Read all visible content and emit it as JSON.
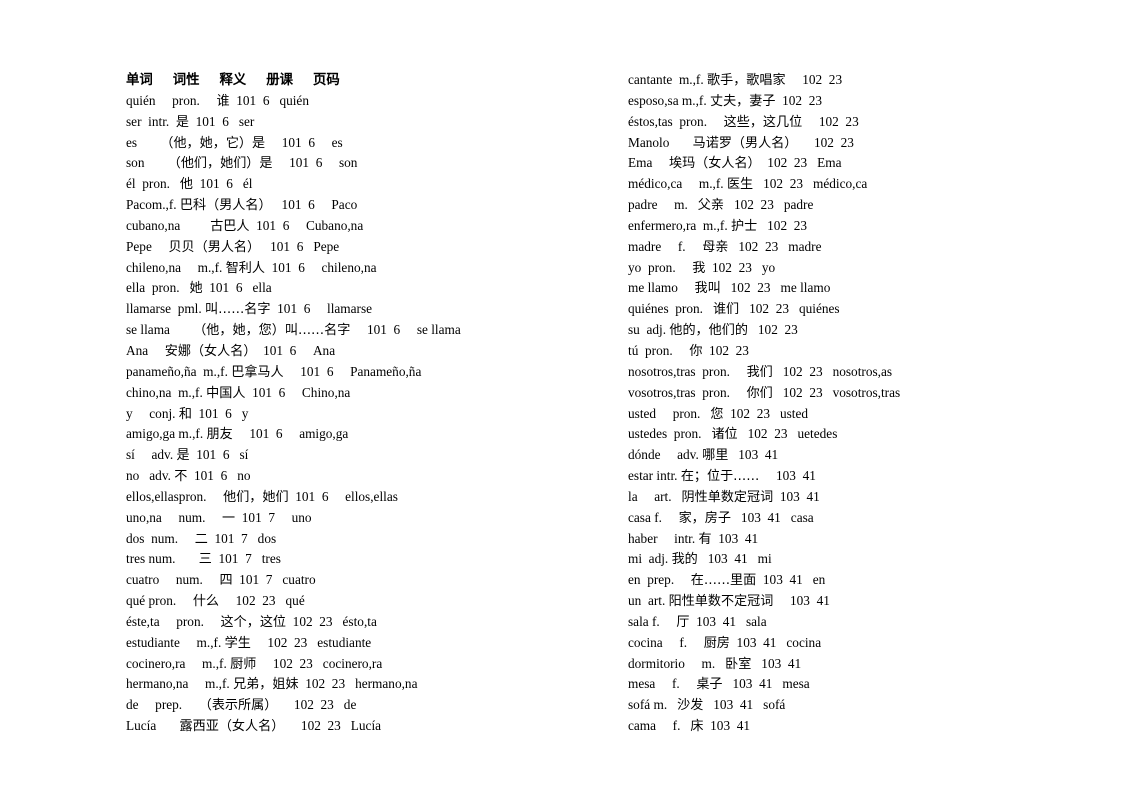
{
  "document": {
    "title": "Spanish-Chinese vocabulary glossary",
    "columns_count": 2
  },
  "header": {
    "columns": [
      "单词",
      "词性",
      "释义",
      "册课",
      "页码"
    ],
    "raw": "单词  词性  释义  册课  页码"
  },
  "left_column": {
    "rows": [
      "quién  pron.  谁  101  6  quién",
      "ser  intr.  是  101  6  ser",
      "es   （他，她，它）是  101  6   es",
      "son   （他们，她们）是  101  6   son",
      "él  pron.  他  101  6  él",
      "Pacom.,f. 巴科（男人名）  101  6   Paco",
      "cubano,na    古巴人  101  6   Cubano,na",
      "Pepe   贝贝（男人名）  101  6  Pepe",
      "chileno,na   m.,f. 智利人  101  6   chileno,na",
      "ella  pron.  她  101  6  ella",
      "llamarse  pml. 叫……名字  101  6   llamarse",
      "se llama   （他，她，您）叫……名字  101  6   se llama",
      "Ana  安娜（女人名）  101  6   Ana",
      "panameño,ña  m.,f. 巴拿马人  101  6   Panameño,ña",
      "chino,na  m.,f. 中国人  101  6   Chino,na",
      "y   conj. 和  101  6  y",
      "amigo,ga m.,f. 朋友  101  6   amigo,ga",
      "sí   adv. 是  101  6  sí",
      "no  adv. 不  101  6  no",
      "ellos,ellaspron.  他们，她们  101  6   ellos,ellas",
      "uno,na   num.  一  101  7   uno",
      "dos  num.  二  101  7  dos",
      "tres num.   三  101  7  tres",
      "cuatro   num.  四  101  7  cuatro",
      "qué pron.  什么  102  23  qué",
      "éste,ta   pron.  这个，这位  102  23  ésto,ta",
      "estudiante  m.,f. 学生  102  23  estudiante",
      "cocinero,ra  m.,f. 厨师  102  23  cocinero,ra",
      "hermano,na  m.,f. 兄弟，姐妹  102  23  hermano,na",
      "de   prep.  （表示所属）  102  23  de",
      "Lucía   露西亚（女人名）  102  23  Lucía"
    ],
    "entries": [
      {
        "word": "quién",
        "pos": "pron.",
        "meaning": "谁",
        "book": "101",
        "lesson": "6",
        "form": "quién"
      },
      {
        "word": "ser",
        "pos": "intr.",
        "meaning": "是",
        "book": "101",
        "lesson": "6",
        "form": "ser"
      },
      {
        "word": "es",
        "pos": "",
        "meaning": "（他，她，它）是",
        "book": "101",
        "lesson": "6",
        "form": "es"
      },
      {
        "word": "son",
        "pos": "",
        "meaning": "（他们，她们）是",
        "book": "101",
        "lesson": "6",
        "form": "son"
      },
      {
        "word": "él",
        "pos": "pron.",
        "meaning": "他",
        "book": "101",
        "lesson": "6",
        "form": "él"
      },
      {
        "word": "Paco",
        "pos": "m.,f.",
        "meaning": "巴科（男人名）",
        "book": "101",
        "lesson": "6",
        "form": "Paco"
      },
      {
        "word": "cubano,na",
        "pos": "",
        "meaning": "古巴人",
        "book": "101",
        "lesson": "6",
        "form": "Cubano,na"
      },
      {
        "word": "Pepe",
        "pos": "",
        "meaning": "贝贝（男人名）",
        "book": "101",
        "lesson": "6",
        "form": "Pepe"
      },
      {
        "word": "chileno,na",
        "pos": "m.,f.",
        "meaning": "智利人",
        "book": "101",
        "lesson": "6",
        "form": "chileno,na"
      },
      {
        "word": "ella",
        "pos": "pron.",
        "meaning": "她",
        "book": "101",
        "lesson": "6",
        "form": "ella"
      },
      {
        "word": "llamarse",
        "pos": "pml.",
        "meaning": "叫……名字",
        "book": "101",
        "lesson": "6",
        "form": "llamarse"
      },
      {
        "word": "se llama",
        "pos": "",
        "meaning": "（他，她，您）叫……名字",
        "book": "101",
        "lesson": "6",
        "form": "se llama"
      },
      {
        "word": "Ana",
        "pos": "",
        "meaning": "安娜（女人名）",
        "book": "101",
        "lesson": "6",
        "form": "Ana"
      },
      {
        "word": "panameño,ña",
        "pos": "m.,f.",
        "meaning": "巴拿马人",
        "book": "101",
        "lesson": "6",
        "form": "Panameño,ña"
      },
      {
        "word": "chino,na",
        "pos": "m.,f.",
        "meaning": "中国人",
        "book": "101",
        "lesson": "6",
        "form": "Chino,na"
      },
      {
        "word": "y",
        "pos": "conj.",
        "meaning": "和",
        "book": "101",
        "lesson": "6",
        "form": "y"
      },
      {
        "word": "amigo,ga",
        "pos": "m.,f.",
        "meaning": "朋友",
        "book": "101",
        "lesson": "6",
        "form": "amigo,ga"
      },
      {
        "word": "sí",
        "pos": "adv.",
        "meaning": "是",
        "book": "101",
        "lesson": "6",
        "form": "sí"
      },
      {
        "word": "no",
        "pos": "adv.",
        "meaning": "不",
        "book": "101",
        "lesson": "6",
        "form": "no"
      },
      {
        "word": "ellos,ellas",
        "pos": "pron.",
        "meaning": "他们，她们",
        "book": "101",
        "lesson": "6",
        "form": "ellos,ellas"
      },
      {
        "word": "uno,na",
        "pos": "num.",
        "meaning": "一",
        "book": "101",
        "lesson": "7",
        "form": "uno"
      },
      {
        "word": "dos",
        "pos": "num.",
        "meaning": "二",
        "book": "101",
        "lesson": "7",
        "form": "dos"
      },
      {
        "word": "tres",
        "pos": "num.",
        "meaning": "三",
        "book": "101",
        "lesson": "7",
        "form": "tres"
      },
      {
        "word": "cuatro",
        "pos": "num.",
        "meaning": "四",
        "book": "101",
        "lesson": "7",
        "form": "cuatro"
      },
      {
        "word": "qué",
        "pos": "pron.",
        "meaning": "什么",
        "book": "102",
        "lesson": "23",
        "form": "qué"
      },
      {
        "word": "éste,ta",
        "pos": "pron.",
        "meaning": "这个，这位",
        "book": "102",
        "lesson": "23",
        "form": "ésto,ta"
      },
      {
        "word": "estudiante",
        "pos": "m.,f.",
        "meaning": "学生",
        "book": "102",
        "lesson": "23",
        "form": "estudiante"
      },
      {
        "word": "cocinero,ra",
        "pos": "m.,f.",
        "meaning": "厨师",
        "book": "102",
        "lesson": "23",
        "form": "cocinero,ra"
      },
      {
        "word": "hermano,na",
        "pos": "m.,f.",
        "meaning": "兄弟，姐妹",
        "book": "102",
        "lesson": "23",
        "form": "hermano,na"
      },
      {
        "word": "de",
        "pos": "prep.",
        "meaning": "（表示所属）",
        "book": "102",
        "lesson": "23",
        "form": "de"
      },
      {
        "word": "Lucía",
        "pos": "",
        "meaning": "露西亚（女人名）",
        "book": "102",
        "lesson": "23",
        "form": "Lucía"
      }
    ]
  },
  "right_column": {
    "rows": [
      "cantante  m.,f. 歌手，歌唱家  102  23",
      "esposo,sa m.,f. 丈夫，妻子  102  23",
      "éstos,tas  pron.  这些，这几位  102  23",
      "Manolo   马诺罗（男人名）  102  23",
      "Ema  埃玛（女人名）  102  23  Ema",
      "médico,ca  m.,f. 医生  102  23  médico,ca",
      "padre   m.  父亲  102  23  padre",
      "enfermero,ra  m.,f. 护士  102  23",
      "madre   f.   母亲  102  23  madre",
      "yo  pron.   我  102  23  yo",
      "me llamo  我叫  102  23  me llamo",
      "quiénes  pron.  谁们  102  23  quiénes",
      "su  adj. 他的，他们的  102  23",
      "tú  pron.   你  102  23",
      "nosotros,tras  pron.  我们  102  23  nosotros,as",
      "vosotros,tras  pron.  你们  102  23  vosotros,tras",
      "usted   pron.  您  102  23  usted",
      "ustedes  pron.  诸位  102  23  uetedes",
      "dónde   adv. 哪里  103  41",
      "estar intr. 在；位于……  103  41",
      "la   art.  阴性单数定冠词  103  41",
      "casa f.   家，房子  103  41  casa",
      "haber   intr. 有  103  41",
      "mi  adj. 我的  103  41  mi",
      "en  prep.   在……里面  103  41  en",
      "un  art. 阳性单数不定冠词  103  41",
      "sala f.   厅  103  41  sala",
      "cocina   f.   厨房  103  41  cocina",
      "dormitorio   m.  卧室  103  41",
      "mesa   f.   桌子  103  41  mesa",
      "sofá m.  沙发  103  41  sofá",
      "cama   f.  床  103  41"
    ],
    "entries": [
      {
        "word": "cantante",
        "pos": "m.,f.",
        "meaning": "歌手，歌唱家",
        "book": "102",
        "lesson": "23",
        "form": ""
      },
      {
        "word": "esposo,sa",
        "pos": "m.,f.",
        "meaning": "丈夫，妻子",
        "book": "102",
        "lesson": "23",
        "form": ""
      },
      {
        "word": "éstos,tas",
        "pos": "pron.",
        "meaning": "这些，这几位",
        "book": "102",
        "lesson": "23",
        "form": ""
      },
      {
        "word": "Manolo",
        "pos": "",
        "meaning": "马诺罗（男人名）",
        "book": "102",
        "lesson": "23",
        "form": ""
      },
      {
        "word": "Ema",
        "pos": "",
        "meaning": "埃玛（女人名）",
        "book": "102",
        "lesson": "23",
        "form": "Ema"
      },
      {
        "word": "médico,ca",
        "pos": "m.,f.",
        "meaning": "医生",
        "book": "102",
        "lesson": "23",
        "form": "médico,ca"
      },
      {
        "word": "padre",
        "pos": "m.",
        "meaning": "父亲",
        "book": "102",
        "lesson": "23",
        "form": "padre"
      },
      {
        "word": "enfermero,ra",
        "pos": "m.,f.",
        "meaning": "护士",
        "book": "102",
        "lesson": "23",
        "form": ""
      },
      {
        "word": "madre",
        "pos": "f.",
        "meaning": "母亲",
        "book": "102",
        "lesson": "23",
        "form": "madre"
      },
      {
        "word": "yo",
        "pos": "pron.",
        "meaning": "我",
        "book": "102",
        "lesson": "23",
        "form": "yo"
      },
      {
        "word": "me llamo",
        "pos": "",
        "meaning": "我叫",
        "book": "102",
        "lesson": "23",
        "form": "me llamo"
      },
      {
        "word": "quiénes",
        "pos": "pron.",
        "meaning": "谁们",
        "book": "102",
        "lesson": "23",
        "form": "quiénes"
      },
      {
        "word": "su",
        "pos": "adj.",
        "meaning": "他的，他们的",
        "book": "102",
        "lesson": "23",
        "form": ""
      },
      {
        "word": "tú",
        "pos": "pron.",
        "meaning": "你",
        "book": "102",
        "lesson": "23",
        "form": ""
      },
      {
        "word": "nosotros,tras",
        "pos": "pron.",
        "meaning": "我们",
        "book": "102",
        "lesson": "23",
        "form": "nosotros,as"
      },
      {
        "word": "vosotros,tras",
        "pos": "pron.",
        "meaning": "你们",
        "book": "102",
        "lesson": "23",
        "form": "vosotros,tras"
      },
      {
        "word": "usted",
        "pos": "pron.",
        "meaning": "您",
        "book": "102",
        "lesson": "23",
        "form": "usted"
      },
      {
        "word": "ustedes",
        "pos": "pron.",
        "meaning": "诸位",
        "book": "102",
        "lesson": "23",
        "form": "uetedes"
      },
      {
        "word": "dónde",
        "pos": "adv.",
        "meaning": "哪里",
        "book": "103",
        "lesson": "41",
        "form": ""
      },
      {
        "word": "estar",
        "pos": "intr.",
        "meaning": "在；位于……",
        "book": "103",
        "lesson": "41",
        "form": ""
      },
      {
        "word": "la",
        "pos": "art.",
        "meaning": "阴性单数定冠词",
        "book": "103",
        "lesson": "41",
        "form": ""
      },
      {
        "word": "casa",
        "pos": "f.",
        "meaning": "家，房子",
        "book": "103",
        "lesson": "41",
        "form": "casa"
      },
      {
        "word": "haber",
        "pos": "intr.",
        "meaning": "有",
        "book": "103",
        "lesson": "41",
        "form": ""
      },
      {
        "word": "mi",
        "pos": "adj.",
        "meaning": "我的",
        "book": "103",
        "lesson": "41",
        "form": "mi"
      },
      {
        "word": "en",
        "pos": "prep.",
        "meaning": "在……里面",
        "book": "103",
        "lesson": "41",
        "form": "en"
      },
      {
        "word": "un",
        "pos": "art.",
        "meaning": "阳性单数不定冠词",
        "book": "103",
        "lesson": "41",
        "form": ""
      },
      {
        "word": "sala",
        "pos": "f.",
        "meaning": "厅",
        "book": "103",
        "lesson": "41",
        "form": "sala"
      },
      {
        "word": "cocina",
        "pos": "f.",
        "meaning": "厨房",
        "book": "103",
        "lesson": "41",
        "form": "cocina"
      },
      {
        "word": "dormitorio",
        "pos": "m.",
        "meaning": "卧室",
        "book": "103",
        "lesson": "41",
        "form": ""
      },
      {
        "word": "mesa",
        "pos": "f.",
        "meaning": "桌子",
        "book": "103",
        "lesson": "41",
        "form": "mesa"
      },
      {
        "word": "sofá",
        "pos": "m.",
        "meaning": "沙发",
        "book": "103",
        "lesson": "41",
        "form": "sofá"
      },
      {
        "word": "cama",
        "pos": "f.",
        "meaning": "床",
        "book": "103",
        "lesson": "41",
        "form": ""
      }
    ]
  }
}
